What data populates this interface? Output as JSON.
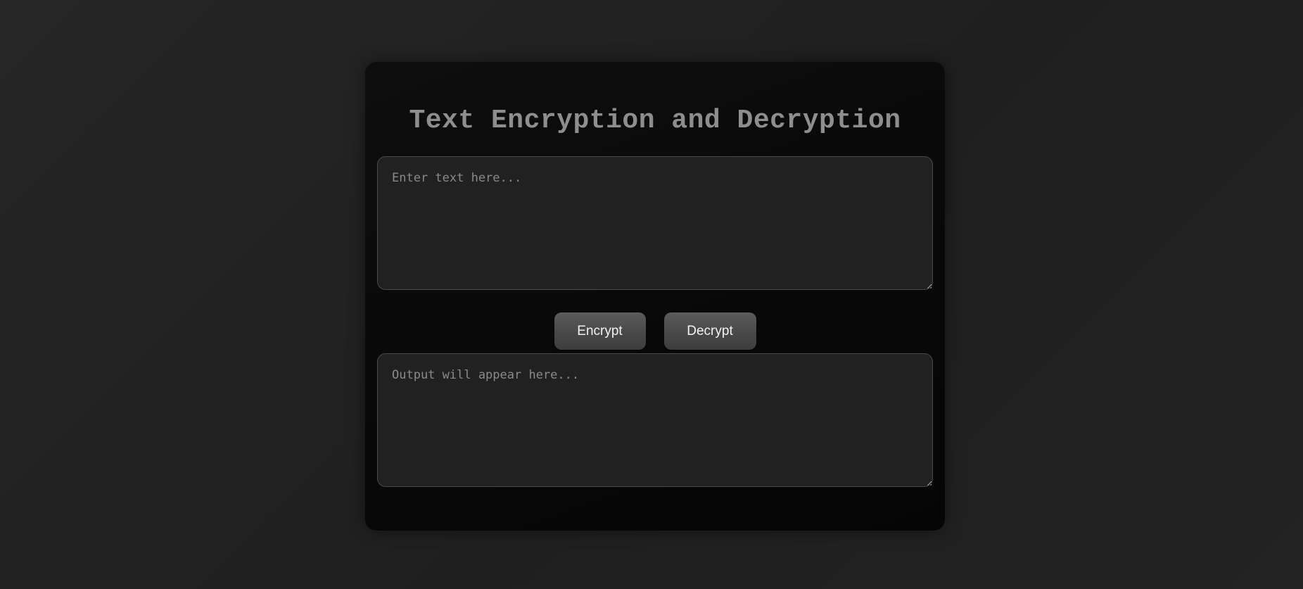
{
  "app": {
    "title": "Text Encryption and Decryption"
  },
  "input": {
    "placeholder": "Enter text here...",
    "value": ""
  },
  "buttons": {
    "encrypt_label": "Encrypt",
    "decrypt_label": "Decrypt"
  },
  "output": {
    "placeholder": "Output will appear here...",
    "value": ""
  },
  "colors": {
    "background": "#222222",
    "card": "#080808",
    "field": "#212121",
    "title": "#8e8e8e",
    "button": "#4a4a4a",
    "button_text": "#f2f2f2"
  }
}
